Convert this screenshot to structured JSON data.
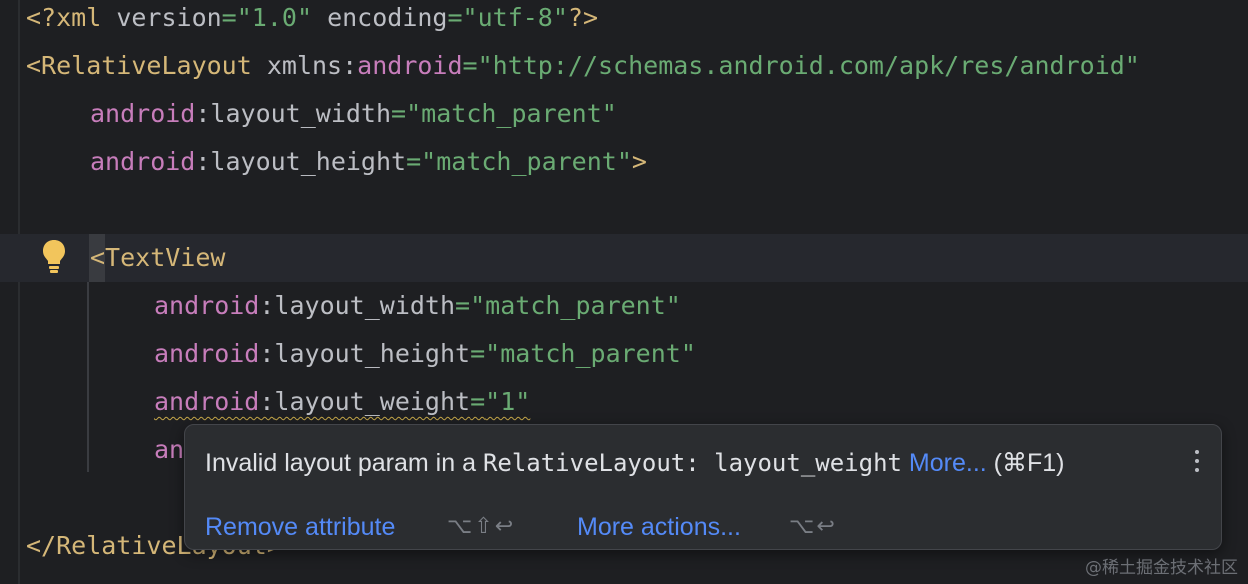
{
  "editor": {
    "lines": {
      "l1": {
        "open": "<?xml ",
        "a1": "version",
        "eq1": "=",
        "v1": "\"1.0\"",
        "sp": " ",
        "a2": "encoding",
        "eq2": "=",
        "v2": "\"utf-8\"",
        "close": "?>"
      },
      "l2": {
        "tag": "<RelativeLayout",
        "sp": " ",
        "attr": "xmlns",
        "colon": ":",
        "ns": "android",
        "eq": "=",
        "val": "\"http://schemas.android.com/apk/res/android\""
      },
      "l3": {
        "ns": "android",
        "colon": ":",
        "attr": "layout_width",
        "eq": "=",
        "val": "\"match_parent\""
      },
      "l4": {
        "ns": "android",
        "colon": ":",
        "attr": "layout_height",
        "eq": "=",
        "val": "\"match_parent\"",
        "close": ">"
      },
      "l6": {
        "tag": "<TextView"
      },
      "l7": {
        "ns": "android",
        "colon": ":",
        "attr": "layout_width",
        "eq": "=",
        "val": "\"match_parent\""
      },
      "l8": {
        "ns": "android",
        "colon": ":",
        "attr": "layout_height",
        "eq": "=",
        "val": "\"match_parent\""
      },
      "l9": {
        "ns": "android",
        "colon": ":",
        "attr": "layout_weight",
        "eq": "=",
        "val": "\"1\""
      },
      "l10": {
        "partial": "an"
      },
      "l12": {
        "tag": "</RelativeLayout>"
      }
    }
  },
  "popup": {
    "message_prefix": "Invalid layout param in a ",
    "message_code": "RelativeLayout: layout_weight",
    "more_link": "More...",
    "more_shortcut": "(⌘F1)",
    "action1_label": "Remove attribute",
    "action1_shortcut": "⌥⇧↩",
    "action2_label": "More actions...",
    "action2_shortcut": "⌥↩"
  },
  "icons": {
    "bulb": "lightbulb-icon",
    "kebab": "more-vertical-icon"
  },
  "colors": {
    "background": "#1e1f22",
    "tag": "#d5b778",
    "namespace": "#c77dbb",
    "string": "#6aab73",
    "link": "#548af7",
    "warning": "#c8a94a"
  },
  "watermark": "@稀土掘金技术社区"
}
